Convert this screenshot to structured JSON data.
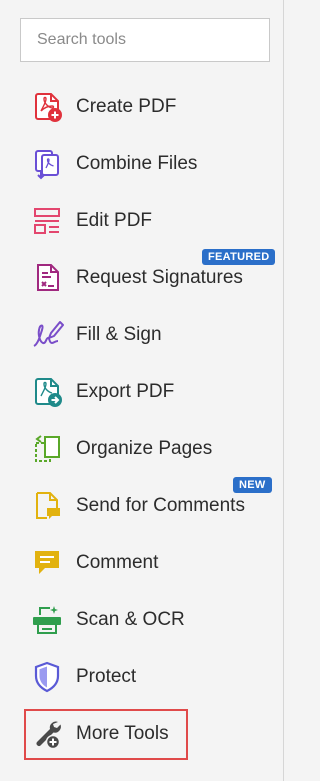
{
  "search": {
    "placeholder": "Search tools"
  },
  "tools": [
    {
      "label": "Create PDF",
      "icon": "create-pdf-icon",
      "color": "#e0323c"
    },
    {
      "label": "Combine Files",
      "icon": "combine-files-icon",
      "color": "#6a4fd6"
    },
    {
      "label": "Edit PDF",
      "icon": "edit-pdf-icon",
      "color": "#e3466e"
    },
    {
      "label": "Request Signatures",
      "icon": "request-signatures-icon",
      "color": "#a0287f",
      "badge": "FEATURED"
    },
    {
      "label": "Fill & Sign",
      "icon": "fill-sign-icon",
      "color": "#7a4ec9"
    },
    {
      "label": "Export PDF",
      "icon": "export-pdf-icon",
      "color": "#1f8a8a"
    },
    {
      "label": "Organize Pages",
      "icon": "organize-pages-icon",
      "color": "#5aa829"
    },
    {
      "label": "Send for Comments",
      "icon": "send-for-comments-icon",
      "color": "#e2b20f",
      "badge": "NEW"
    },
    {
      "label": "Comment",
      "icon": "comment-icon",
      "color": "#e2b20f"
    },
    {
      "label": "Scan & OCR",
      "icon": "scan-ocr-icon",
      "color": "#2f9e4d"
    },
    {
      "label": "Protect",
      "icon": "protect-icon",
      "color": "#5a5ad6"
    },
    {
      "label": "More Tools",
      "icon": "more-tools-icon",
      "color": "#4a4a4a"
    }
  ],
  "colors": {
    "badge": "#2b6fc9",
    "highlight": "#e04a4a"
  }
}
